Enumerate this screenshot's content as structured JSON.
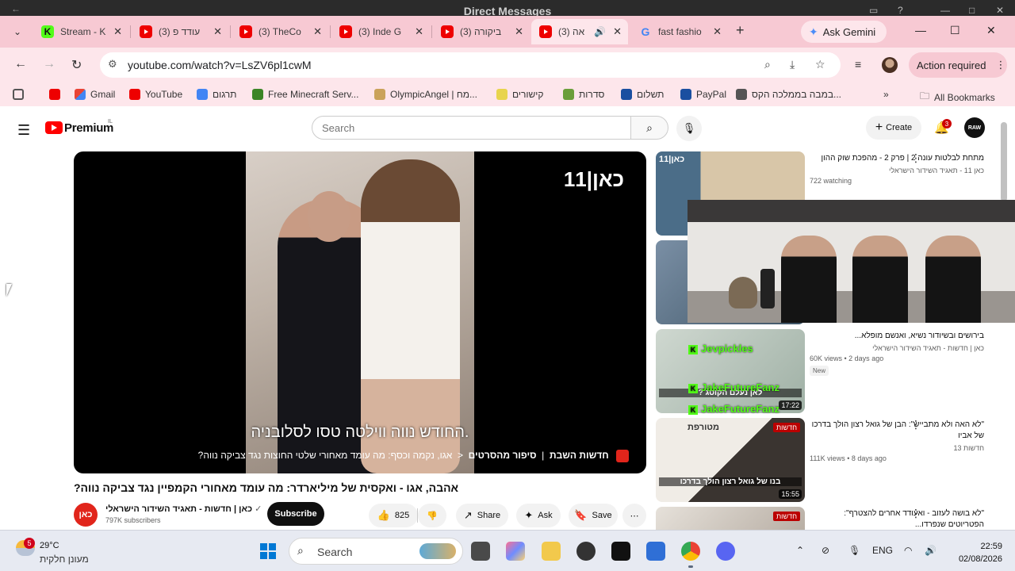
{
  "window": {
    "title": "Direct Messages"
  },
  "tabs": [
    {
      "label": "Stream - K",
      "favicon": "kick"
    },
    {
      "label": "(3) עודד פ",
      "favicon": "youtube"
    },
    {
      "label": "(3) TheCo",
      "favicon": "youtube"
    },
    {
      "label": "(3) Inde G",
      "favicon": "youtube"
    },
    {
      "label": "(3) ביקורה",
      "favicon": "youtube"
    },
    {
      "label": "(3) אה",
      "favicon": "youtube",
      "active": true
    },
    {
      "label": "fast fashio",
      "favicon": "google"
    }
  ],
  "gemini_label": "Ask Gemini",
  "address": {
    "url": "youtube.com/watch?v=LsZV6pl1cwM"
  },
  "action_required": "Action required",
  "bookmarks": [
    {
      "label": ""
    },
    {
      "label": "Gmail"
    },
    {
      "label": "YouTube"
    },
    {
      "label": "תרגום"
    },
    {
      "label": "Free Minecraft Serv..."
    },
    {
      "label": "OlympicAngel | מח..."
    },
    {
      "label": "קישורים"
    },
    {
      "label": "סדרות"
    },
    {
      "label": "תשלום"
    },
    {
      "label": "PayPal"
    },
    {
      "label": "במבה בממלכה הקס..."
    }
  ],
  "all_bookmarks": "All Bookmarks",
  "youtube": {
    "logo_text": "Premium",
    "region": "IL",
    "search_placeholder": "Search",
    "create_label": "Create",
    "notif_count": "3",
    "avatar_text": "RAW"
  },
  "video": {
    "logo": "כאן|11",
    "subtitle": "החודש נווה ווילטה טסו לסלובניה.",
    "ticker_part1": "חדשות השבת",
    "ticker_part2": "סיפור מהסרטים",
    "ticker_part3": "אגו, נקמה וכסף: מה עומד מאחורי שלטי החוצות נגד צביקה נווה?",
    "title": "אהבה, אגו - ואקסית של מיליארדר: מה עומד מאחורי הקמפיין נגד צביקה נווה?",
    "channel_name": "כאן | חדשות - תאגיד השידור הישראלי",
    "channel_avatar": "כאן",
    "subscribers": "797K subscribers",
    "subscribe_label": "Subscribe",
    "likes": "825",
    "share_label": "Share",
    "ask_label": "Ask",
    "save_label": "Save"
  },
  "recommendations": [
    {
      "title": "מתחת לבלטות עונה 2 | פרק 2 - מהפכת שוק ההון",
      "channel": "כאן 11 - תאגיד השידור הישראלי",
      "views": "722 watching",
      "thumb_logo": "כאן|11"
    },
    {
      "title": "",
      "channel": "",
      "views": ""
    },
    {
      "title": "בירושים ובשיודור נשיא, ואנשם מופלא...",
      "channel": "כאן | חדשות - תאגיד השידור הישראלי",
      "views": "60K views • 2 days ago",
      "badge": "New",
      "duration": "17:22",
      "thumb_text": "לאן נעלם הקוטג ?"
    },
    {
      "title": "\"לא האה ולא מתבייש\": הבן של גואל רצון הולך בדרכו של אביו",
      "channel": "חדשות 13",
      "views": "111K views • 8 days ago",
      "duration": "15:55",
      "thumb_text": "בנו של גואל רצון הולך בדרכו",
      "thumb_tag": "חדשות",
      "thumb_logo": "מטורפת"
    },
    {
      "title": "\"לא בושה לעזוב - ואעודד אחרים להצטרף\": הפטריוטים שנפרדו...",
      "channel": "",
      "views": "",
      "thumb_tag": "חדשות"
    }
  ],
  "chat_overlay": [
    {
      "user": "Jevpickles"
    },
    {
      "user": "JakeFutureFanz"
    },
    {
      "user": "JakeFutureFanz"
    }
  ],
  "taskbar": {
    "weather_badge": "5",
    "temperature": "29°C",
    "weather_desc": "מעונן חלקית",
    "search_label": "Search",
    "language": "ENG",
    "time": "22:59",
    "date": "02/08/2026"
  }
}
